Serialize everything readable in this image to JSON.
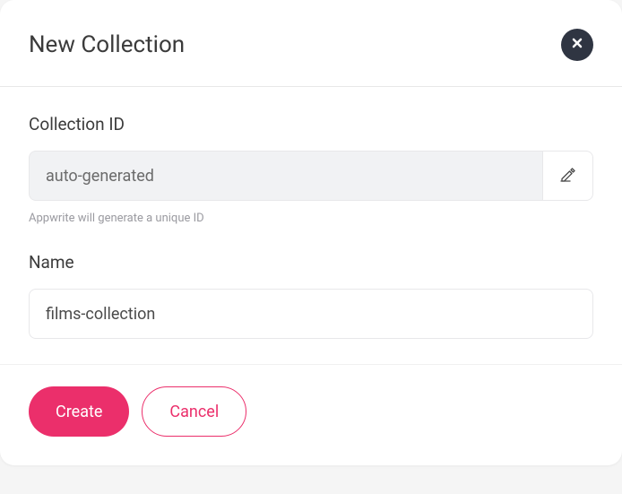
{
  "modal": {
    "title": "New Collection",
    "fields": {
      "collection_id": {
        "label": "Collection ID",
        "value": "auto-generated",
        "helper": "Appwrite will generate a unique ID"
      },
      "name": {
        "label": "Name",
        "value": "films-collection"
      }
    },
    "buttons": {
      "create": "Create",
      "cancel": "Cancel"
    }
  }
}
